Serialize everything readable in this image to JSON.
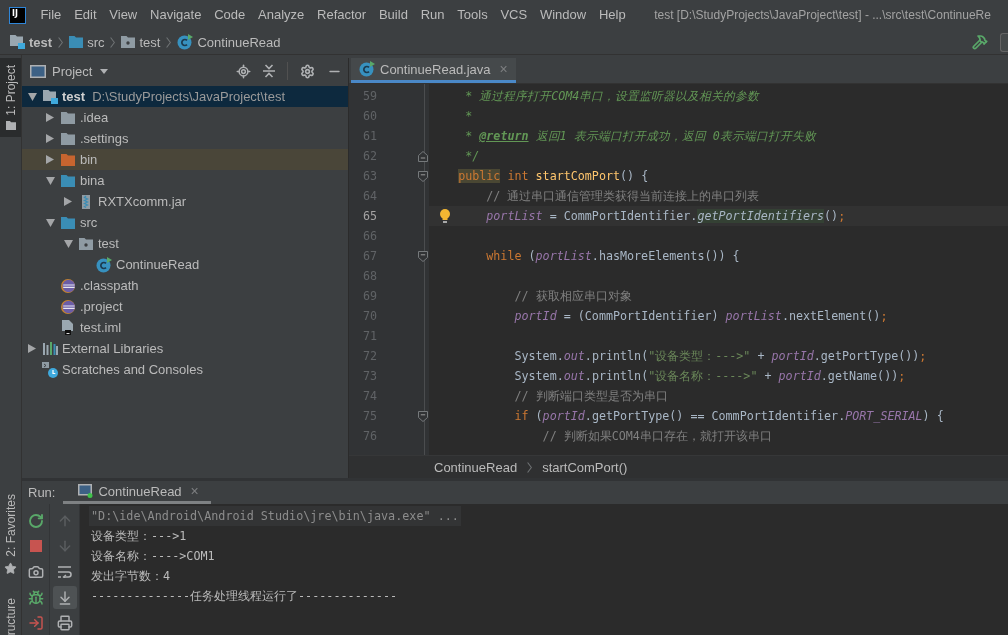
{
  "window": {
    "logo": "IJ",
    "menu": [
      "File",
      "Edit",
      "View",
      "Navigate",
      "Code",
      "Analyze",
      "Refactor",
      "Build",
      "Run",
      "Tools",
      "VCS",
      "Window",
      "Help"
    ],
    "title": "test [D:\\StudyProjects\\JavaProject\\test] - ...\\src\\test\\ContinueRe"
  },
  "navigation_bar": {
    "items": [
      {
        "label": "test",
        "kind": "module"
      },
      {
        "label": "src",
        "kind": "source-folder"
      },
      {
        "label": "test",
        "kind": "package"
      },
      {
        "label": "ContinueRead",
        "kind": "class"
      }
    ]
  },
  "tool_strip": {
    "top": [
      {
        "label": "1: Project",
        "kind": "project",
        "selected": true
      }
    ],
    "bottom": [
      {
        "label": "2: Favorites",
        "kind": "favorites",
        "selected": false
      },
      {
        "label": "ructure",
        "kind": "structure",
        "selected": false
      }
    ]
  },
  "project_panel": {
    "title": "Project",
    "tree": [
      {
        "label": "test",
        "path": "D:\\StudyProjects\\JavaProject\\test",
        "kind": "module",
        "expanded": true,
        "selected": true,
        "highlighted": false,
        "children": [
          {
            "label": ".idea",
            "kind": "folder",
            "expanded": false,
            "selected": false,
            "highlighted": false
          },
          {
            "label": ".settings",
            "kind": "folder",
            "expanded": false,
            "selected": false,
            "highlighted": false
          },
          {
            "label": "bin",
            "kind": "excluded-folder",
            "expanded": false,
            "selected": false,
            "highlighted": true
          },
          {
            "label": "bina",
            "kind": "source-folder",
            "expanded": true,
            "selected": false,
            "highlighted": false,
            "children": [
              {
                "label": "RXTXcomm.jar",
                "kind": "jar",
                "expanded": false,
                "selected": false,
                "highlighted": false
              }
            ]
          },
          {
            "label": "src",
            "kind": "source-folder",
            "expanded": true,
            "selected": false,
            "highlighted": false,
            "children": [
              {
                "label": "test",
                "kind": "package",
                "expanded": true,
                "selected": false,
                "highlighted": false,
                "children": [
                  {
                    "label": "ContinueRead",
                    "kind": "class",
                    "selected": false,
                    "highlighted": false
                  }
                ]
              }
            ]
          },
          {
            "label": ".classpath",
            "kind": "eclipse-file",
            "selected": false,
            "highlighted": false
          },
          {
            "label": ".project",
            "kind": "eclipse-file",
            "selected": false,
            "highlighted": false
          },
          {
            "label": "test.iml",
            "kind": "module-file",
            "selected": false,
            "highlighted": false
          }
        ]
      },
      {
        "label": "External Libraries",
        "kind": "libraries",
        "expanded": false,
        "selected": false,
        "highlighted": false
      },
      {
        "label": "Scratches and Consoles",
        "kind": "scratches",
        "selected": false,
        "highlighted": false
      }
    ]
  },
  "editor": {
    "tabs": [
      {
        "label": "ContinueRead.java",
        "close": "×",
        "selected": true
      }
    ],
    "intention_bulb": true,
    "lines": [
      {
        "number": "59",
        "current": false,
        "fold_start": false,
        "fold_end": false,
        "tokens": [
          {
            "kind": "doc",
            "text": "     * 通过程序打开COM4串口，设置监听器以及相关的参数"
          }
        ]
      },
      {
        "number": "60",
        "current": false,
        "fold_start": false,
        "fold_end": false,
        "tokens": [
          {
            "kind": "doc",
            "text": "     *"
          }
        ]
      },
      {
        "number": "61",
        "current": false,
        "fold_start": false,
        "fold_end": false,
        "tokens": [
          {
            "kind": "doc",
            "text": "     * "
          },
          {
            "kind": "doc-tag",
            "text": "@return"
          },
          {
            "kind": "doc",
            "text": " 返回1 表示端口打开成功，返回 0表示端口打开失败"
          }
        ]
      },
      {
        "number": "62",
        "current": false,
        "fold_start": false,
        "fold_end": true,
        "tokens": [
          {
            "kind": "doc",
            "text": "     */"
          }
        ]
      },
      {
        "number": "63",
        "current": false,
        "fold_start": true,
        "fold_end": false,
        "tokens": [
          {
            "kind": "keyword-hl",
            "text": "    public"
          },
          {
            "kind": "keyword",
            "text": " int "
          },
          {
            "kind": "method-decl",
            "text": "startComPort"
          },
          {
            "kind": "plain",
            "text": "() {"
          }
        ]
      },
      {
        "number": "64",
        "current": false,
        "fold_start": false,
        "fold_end": false,
        "tokens": [
          {
            "kind": "comment",
            "text": "        // 通过串口通信管理类获得当前连接上的串口列表"
          }
        ]
      },
      {
        "number": "65",
        "current": true,
        "fold_start": false,
        "fold_end": false,
        "tokens": [
          {
            "kind": "field",
            "text": "        portList"
          },
          {
            "kind": "plain",
            "text": " = CommPortIdentifier."
          },
          {
            "kind": "static-call-hl",
            "text": "getPortIdentifiers"
          },
          {
            "kind": "plain",
            "text": "()"
          },
          {
            "kind": "separator",
            "text": ";"
          }
        ]
      },
      {
        "number": "66",
        "current": false,
        "fold_start": false,
        "fold_end": false
      },
      {
        "number": "67",
        "current": false,
        "fold_start": true,
        "fold_end": false,
        "tokens": [
          {
            "kind": "keyword",
            "text": "        while"
          },
          {
            "kind": "plain",
            "text": " ("
          },
          {
            "kind": "field",
            "text": "portList"
          },
          {
            "kind": "plain",
            "text": ".hasMoreElements()) {"
          }
        ]
      },
      {
        "number": "68",
        "current": false,
        "fold_start": false,
        "fold_end": false
      },
      {
        "number": "69",
        "current": false,
        "fold_start": false,
        "fold_end": false,
        "tokens": [
          {
            "kind": "comment",
            "text": "            // 获取相应串口对象"
          }
        ]
      },
      {
        "number": "70",
        "current": false,
        "fold_start": false,
        "fold_end": false,
        "tokens": [
          {
            "kind": "field",
            "text": "            portId"
          },
          {
            "kind": "plain",
            "text": " = (CommPortIdentifier) "
          },
          {
            "kind": "field",
            "text": "portList"
          },
          {
            "kind": "plain",
            "text": ".nextElement()"
          },
          {
            "kind": "separator",
            "text": ";"
          }
        ]
      },
      {
        "number": "71",
        "current": false,
        "fold_start": false,
        "fold_end": false
      },
      {
        "number": "72",
        "current": false,
        "fold_start": false,
        "fold_end": false,
        "tokens": [
          {
            "kind": "plain",
            "text": "            System."
          },
          {
            "kind": "field",
            "text": "out"
          },
          {
            "kind": "plain",
            "text": ".println("
          },
          {
            "kind": "string",
            "text": "\"设备类型：--->\""
          },
          {
            "kind": "plain",
            "text": " + "
          },
          {
            "kind": "field",
            "text": "portId"
          },
          {
            "kind": "plain",
            "text": ".getPortType())"
          },
          {
            "kind": "separator",
            "text": ";"
          }
        ]
      },
      {
        "number": "73",
        "current": false,
        "fold_start": false,
        "fold_end": false,
        "tokens": [
          {
            "kind": "plain",
            "text": "            System."
          },
          {
            "kind": "field",
            "text": "out"
          },
          {
            "kind": "plain",
            "text": ".println("
          },
          {
            "kind": "string",
            "text": "\"设备名称：---->\""
          },
          {
            "kind": "plain",
            "text": " + "
          },
          {
            "kind": "field",
            "text": "portId"
          },
          {
            "kind": "plain",
            "text": ".getName())"
          },
          {
            "kind": "separator",
            "text": ";"
          }
        ]
      },
      {
        "number": "74",
        "current": false,
        "fold_start": false,
        "fold_end": false,
        "tokens": [
          {
            "kind": "comment",
            "text": "            // 判断端口类型是否为串口"
          }
        ]
      },
      {
        "number": "75",
        "current": false,
        "fold_start": true,
        "fold_end": false,
        "tokens": [
          {
            "kind": "keyword",
            "text": "            if"
          },
          {
            "kind": "plain",
            "text": " ("
          },
          {
            "kind": "field",
            "text": "portId"
          },
          {
            "kind": "plain",
            "text": ".getPortType() == CommPortIdentifier."
          },
          {
            "kind": "field",
            "text": "PORT_SERIAL"
          },
          {
            "kind": "plain",
            "text": ") {"
          }
        ]
      },
      {
        "number": "76",
        "current": false,
        "fold_start": false,
        "fold_end": false,
        "tokens": [
          {
            "kind": "comment",
            "text": "                // 判断如果COM4串口存在，就打开该串口"
          }
        ]
      }
    ],
    "breadcrumbs": [
      "ContinueRead",
      "startComPort()"
    ]
  },
  "run_panel": {
    "label": "Run:",
    "tabs": [
      {
        "label": "ContinueRead",
        "close": "×",
        "selected": true
      }
    ],
    "toolbar_main": [
      {
        "kind": "rerun",
        "disabled": false,
        "on": false
      },
      {
        "kind": "stop",
        "disabled": false,
        "on": false
      },
      {
        "kind": "camera",
        "disabled": false,
        "on": false
      },
      {
        "kind": "bug",
        "disabled": false,
        "on": false
      },
      {
        "kind": "exit",
        "disabled": false,
        "on": false
      }
    ],
    "toolbar_console": [
      {
        "kind": "up",
        "disabled": true,
        "on": false
      },
      {
        "kind": "down",
        "disabled": true,
        "on": false
      },
      {
        "kind": "wrap",
        "disabled": false,
        "on": false
      },
      {
        "kind": "scroll-end",
        "disabled": false,
        "on": true
      },
      {
        "kind": "print",
        "disabled": false,
        "on": false
      }
    ],
    "console": [
      {
        "kind": "command",
        "text": "\"D:\\ide\\Android\\Android Studio\\jre\\bin\\java.exe\" ..."
      },
      {
        "kind": "output",
        "text": "设备类型：--->1"
      },
      {
        "kind": "output",
        "text": "设备名称：---->COM1"
      },
      {
        "kind": "output",
        "text": "发出字节数：4"
      },
      {
        "kind": "output",
        "text": "--------------任务处理线程运行了--------------"
      }
    ]
  }
}
